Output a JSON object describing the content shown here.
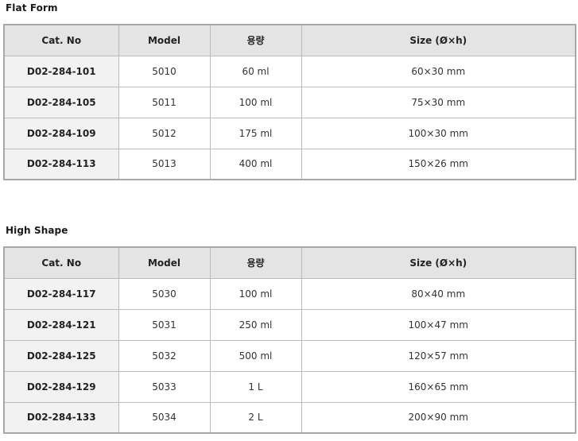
{
  "flat_form": {
    "title": "Flat Form",
    "headers": [
      "Cat. No",
      "Model",
      "용량",
      "Size (Ø×h)"
    ],
    "rows": [
      {
        "cat_no": "D02-284-101",
        "model": "5010",
        "capacity": "60 ml",
        "size": "60×30 mm"
      },
      {
        "cat_no": "D02-284-105",
        "model": "5011",
        "capacity": "100 ml",
        "size": "75×30 mm"
      },
      {
        "cat_no": "D02-284-109",
        "model": "5012",
        "capacity": "175 ml",
        "size": "100×30 mm"
      },
      {
        "cat_no": "D02-284-113",
        "model": "5013",
        "capacity": "400 ml",
        "size": "150×26 mm"
      }
    ]
  },
  "high_shape": {
    "title": "High Shape",
    "headers": [
      "Cat. No",
      "Model",
      "용량",
      "Size (Ø×h)"
    ],
    "rows": [
      {
        "cat_no": "D02-284-117",
        "model": "5030",
        "capacity": "100 ml",
        "size": "80×40 mm"
      },
      {
        "cat_no": "D02-284-121",
        "model": "5031",
        "capacity": "250 ml",
        "size": "100×47 mm"
      },
      {
        "cat_no": "D02-284-125",
        "model": "5032",
        "capacity": "500 ml",
        "size": "120×57 mm"
      },
      {
        "cat_no": "D02-284-129",
        "model": "5033",
        "capacity": "1 L",
        "size": "160×65 mm"
      },
      {
        "cat_no": "D02-284-133",
        "model": "5034",
        "capacity": "2 L",
        "size": "200×90 mm"
      }
    ]
  },
  "colors": {
    "header_bg": "#e4e4e4",
    "cat_cell_bg": "#f2f2f2",
    "border": "#bcbcbc"
  }
}
